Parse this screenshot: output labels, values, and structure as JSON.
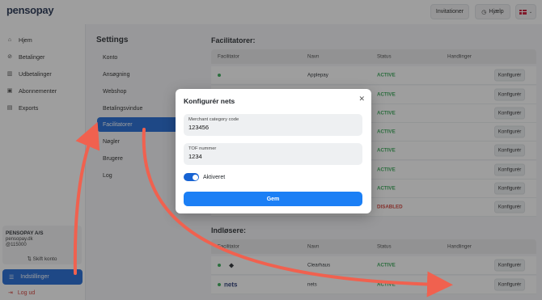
{
  "app": {
    "logo": "pensopay"
  },
  "topbar": {
    "invitations_label": "Invitationer",
    "help_label": "Hjælp"
  },
  "sidebar": {
    "items": [
      {
        "label": "Hjem",
        "icon": "home-icon"
      },
      {
        "label": "Betalinger",
        "icon": "payments-icon"
      },
      {
        "label": "Udbetalinger",
        "icon": "bank-icon"
      },
      {
        "label": "Abonnementer",
        "icon": "calendar-icon"
      },
      {
        "label": "Exports",
        "icon": "file-icon"
      }
    ],
    "org_name": "PENSOPAY A/S",
    "org_domain": "pensopay.dk",
    "org_id": "@115000",
    "switch_account": "Skift konto",
    "settings_label": "Indstillinger",
    "logout_label": "Log ud"
  },
  "settings": {
    "title": "Settings",
    "items": [
      "Konto",
      "Ansøgning",
      "Webshop",
      "Betalingsvindue",
      "Facilitatorer",
      "Nøgler",
      "Brugere",
      "Log"
    ],
    "active": "Facilitatorer"
  },
  "facilitators": {
    "title": "Facilitatorer:",
    "headers": [
      "Facilitator",
      "Navn",
      "Status",
      "Handlinger"
    ],
    "rows": [
      {
        "name": "Applepay",
        "status": "ACTIVE",
        "action": "Konfigurér"
      },
      {
        "name": "",
        "status": "ACTIVE",
        "action": "Konfigurér"
      },
      {
        "name": "",
        "status": "ACTIVE",
        "action": "Konfigurér"
      },
      {
        "name": "",
        "status": "ACTIVE",
        "action": "Konfigurér"
      },
      {
        "name": "",
        "status": "ACTIVE",
        "action": "Konfigurér"
      },
      {
        "name": "",
        "status": "ACTIVE",
        "action": "Konfigurér"
      },
      {
        "name": "",
        "status": "ACTIVE",
        "action": "Konfigurér"
      },
      {
        "name": "",
        "status": "DISABLED",
        "action": "Konfigurér"
      }
    ]
  },
  "acquirers": {
    "title": "Indløsere:",
    "headers": [
      "Facilitator",
      "Navn",
      "Status",
      "Handlinger"
    ],
    "rows": [
      {
        "logo": "",
        "name": "Clearhaus",
        "status": "ACTIVE",
        "action": "Konfigurér"
      },
      {
        "logo": "nets",
        "name": "nets",
        "status": "ACTIVE",
        "action": "Konfigurér"
      }
    ]
  },
  "modal": {
    "title": "Konfigurér nets",
    "mcc_label": "Merchant category code",
    "mcc_value": "123456",
    "tof_label": "TOF nummer",
    "tof_value": "1234",
    "toggle_label": "Aktiveret",
    "toggle_on": true,
    "save_label": "Gem"
  },
  "colors": {
    "accent": "#1763d3",
    "active": "#2ea44f",
    "disabled": "#d0342c",
    "arrow": "#f0614f"
  }
}
